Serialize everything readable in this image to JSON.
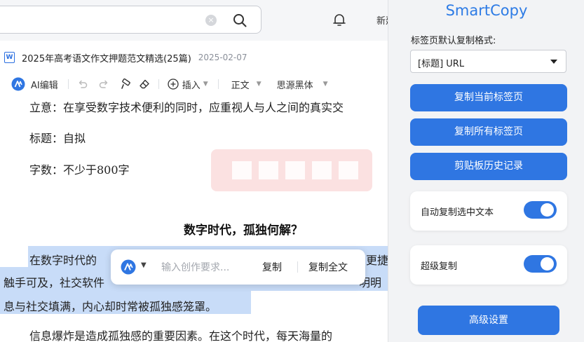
{
  "topbar": {
    "search_clear_glyph": "×",
    "new_label": "新建"
  },
  "file": {
    "icon_letter": "W",
    "title": "2025年高考语文作文押题范文精选(25篇)",
    "date": "2025-02-07"
  },
  "toolbar": {
    "ai_edit": "AI编辑",
    "insert": "插入",
    "text_style": "正文",
    "font": "思源黑体"
  },
  "document": {
    "lines": [
      "立意：在享受数字技术便利的同时，应重视人与人之间的真实交",
      "标题：自拟",
      "字数：不少于800字"
    ],
    "heading": "数字时代，孤独何解？",
    "para1": [
      "在数字时代的",
      "更捷",
      "触手可及，社交软件",
      "明明",
      "息与社交填满，内心却时常被孤独感笼罩。"
    ],
    "para2": "信息爆炸是造成孤独感的重要因素。在这个时代，每天海量的"
  },
  "floating_toolbar": {
    "input_placeholder": "输入创作要求...",
    "copy": "复制",
    "copy_all": "复制全文"
  },
  "panel": {
    "title": "SmartCopy",
    "format_label": "标签页默认复制格式:",
    "format_value": "[标题] URL",
    "buttons": [
      "复制当前标签页",
      "复制所有标签页",
      "剪贴板历史记录"
    ],
    "auto_copy_label": "自动复制选中文本",
    "auto_copy_on": true,
    "super_copy_label": "超级复制",
    "super_copy_on": true,
    "advanced": "高级设置"
  },
  "colors": {
    "accent": "#2f76e2",
    "title_blue": "#2d7be5",
    "selection": "#c8dcf8",
    "watermark": "#fbe1e1"
  }
}
